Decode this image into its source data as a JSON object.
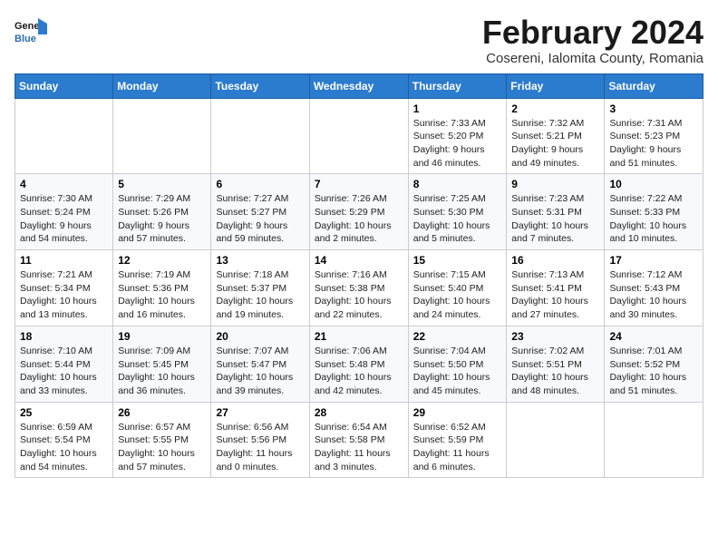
{
  "header": {
    "logo_general": "General",
    "logo_blue": "Blue",
    "month_title": "February 2024",
    "subtitle": "Cosereni, Ialomita County, Romania"
  },
  "weekdays": [
    "Sunday",
    "Monday",
    "Tuesday",
    "Wednesday",
    "Thursday",
    "Friday",
    "Saturday"
  ],
  "weeks": [
    [
      {
        "day": "",
        "info": ""
      },
      {
        "day": "",
        "info": ""
      },
      {
        "day": "",
        "info": ""
      },
      {
        "day": "",
        "info": ""
      },
      {
        "day": "1",
        "info": "Sunrise: 7:33 AM\nSunset: 5:20 PM\nDaylight: 9 hours\nand 46 minutes."
      },
      {
        "day": "2",
        "info": "Sunrise: 7:32 AM\nSunset: 5:21 PM\nDaylight: 9 hours\nand 49 minutes."
      },
      {
        "day": "3",
        "info": "Sunrise: 7:31 AM\nSunset: 5:23 PM\nDaylight: 9 hours\nand 51 minutes."
      }
    ],
    [
      {
        "day": "4",
        "info": "Sunrise: 7:30 AM\nSunset: 5:24 PM\nDaylight: 9 hours\nand 54 minutes."
      },
      {
        "day": "5",
        "info": "Sunrise: 7:29 AM\nSunset: 5:26 PM\nDaylight: 9 hours\nand 57 minutes."
      },
      {
        "day": "6",
        "info": "Sunrise: 7:27 AM\nSunset: 5:27 PM\nDaylight: 9 hours\nand 59 minutes."
      },
      {
        "day": "7",
        "info": "Sunrise: 7:26 AM\nSunset: 5:29 PM\nDaylight: 10 hours\nand 2 minutes."
      },
      {
        "day": "8",
        "info": "Sunrise: 7:25 AM\nSunset: 5:30 PM\nDaylight: 10 hours\nand 5 minutes."
      },
      {
        "day": "9",
        "info": "Sunrise: 7:23 AM\nSunset: 5:31 PM\nDaylight: 10 hours\nand 7 minutes."
      },
      {
        "day": "10",
        "info": "Sunrise: 7:22 AM\nSunset: 5:33 PM\nDaylight: 10 hours\nand 10 minutes."
      }
    ],
    [
      {
        "day": "11",
        "info": "Sunrise: 7:21 AM\nSunset: 5:34 PM\nDaylight: 10 hours\nand 13 minutes."
      },
      {
        "day": "12",
        "info": "Sunrise: 7:19 AM\nSunset: 5:36 PM\nDaylight: 10 hours\nand 16 minutes."
      },
      {
        "day": "13",
        "info": "Sunrise: 7:18 AM\nSunset: 5:37 PM\nDaylight: 10 hours\nand 19 minutes."
      },
      {
        "day": "14",
        "info": "Sunrise: 7:16 AM\nSunset: 5:38 PM\nDaylight: 10 hours\nand 22 minutes."
      },
      {
        "day": "15",
        "info": "Sunrise: 7:15 AM\nSunset: 5:40 PM\nDaylight: 10 hours\nand 24 minutes."
      },
      {
        "day": "16",
        "info": "Sunrise: 7:13 AM\nSunset: 5:41 PM\nDaylight: 10 hours\nand 27 minutes."
      },
      {
        "day": "17",
        "info": "Sunrise: 7:12 AM\nSunset: 5:43 PM\nDaylight: 10 hours\nand 30 minutes."
      }
    ],
    [
      {
        "day": "18",
        "info": "Sunrise: 7:10 AM\nSunset: 5:44 PM\nDaylight: 10 hours\nand 33 minutes."
      },
      {
        "day": "19",
        "info": "Sunrise: 7:09 AM\nSunset: 5:45 PM\nDaylight: 10 hours\nand 36 minutes."
      },
      {
        "day": "20",
        "info": "Sunrise: 7:07 AM\nSunset: 5:47 PM\nDaylight: 10 hours\nand 39 minutes."
      },
      {
        "day": "21",
        "info": "Sunrise: 7:06 AM\nSunset: 5:48 PM\nDaylight: 10 hours\nand 42 minutes."
      },
      {
        "day": "22",
        "info": "Sunrise: 7:04 AM\nSunset: 5:50 PM\nDaylight: 10 hours\nand 45 minutes."
      },
      {
        "day": "23",
        "info": "Sunrise: 7:02 AM\nSunset: 5:51 PM\nDaylight: 10 hours\nand 48 minutes."
      },
      {
        "day": "24",
        "info": "Sunrise: 7:01 AM\nSunset: 5:52 PM\nDaylight: 10 hours\nand 51 minutes."
      }
    ],
    [
      {
        "day": "25",
        "info": "Sunrise: 6:59 AM\nSunset: 5:54 PM\nDaylight: 10 hours\nand 54 minutes."
      },
      {
        "day": "26",
        "info": "Sunrise: 6:57 AM\nSunset: 5:55 PM\nDaylight: 10 hours\nand 57 minutes."
      },
      {
        "day": "27",
        "info": "Sunrise: 6:56 AM\nSunset: 5:56 PM\nDaylight: 11 hours\nand 0 minutes."
      },
      {
        "day": "28",
        "info": "Sunrise: 6:54 AM\nSunset: 5:58 PM\nDaylight: 11 hours\nand 3 minutes."
      },
      {
        "day": "29",
        "info": "Sunrise: 6:52 AM\nSunset: 5:59 PM\nDaylight: 11 hours\nand 6 minutes."
      },
      {
        "day": "",
        "info": ""
      },
      {
        "day": "",
        "info": ""
      }
    ]
  ]
}
